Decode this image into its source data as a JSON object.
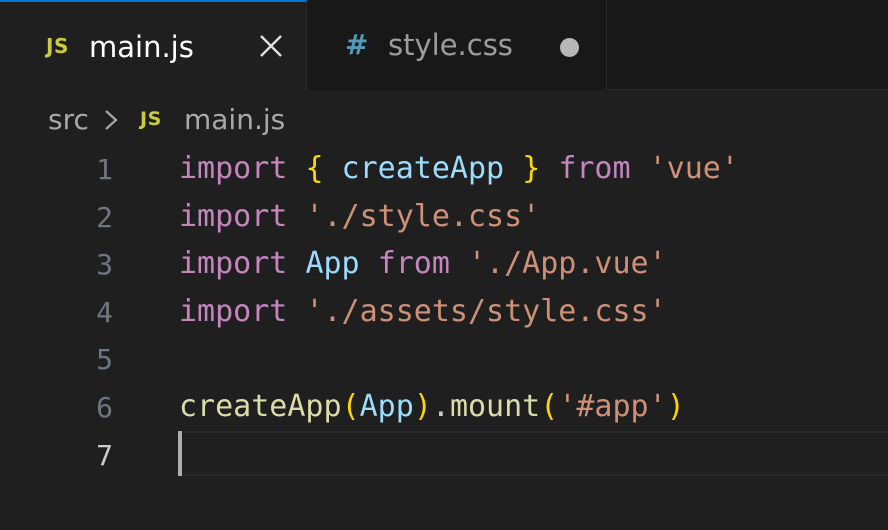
{
  "tabs": [
    {
      "icon": "JS",
      "label": "main.js",
      "active": true,
      "close_glyph": "✕"
    },
    {
      "icon": "#",
      "label": "style.css",
      "active": false,
      "dirty": true
    }
  ],
  "breadcrumb": {
    "folder": "src",
    "separator": "›",
    "file_icon": "JS",
    "file": "main.js"
  },
  "code": {
    "line_numbers": [
      "1",
      "2",
      "3",
      "4",
      "5",
      "6",
      "7"
    ],
    "current_line": 7,
    "lines": [
      {
        "t1": "import",
        "t2": " ",
        "t3": "{",
        "t4": " createApp ",
        "t5": "}",
        "t6": " ",
        "t7": "from",
        "t8": " ",
        "t9": "'vue'"
      },
      {
        "t1": "import",
        "t2": " ",
        "t3": "'./style.css'"
      },
      {
        "t1": "import",
        "t2": " ",
        "t3": "App",
        "t4": " ",
        "t5": "from",
        "t6": " ",
        "t7": "'./App.vue'"
      },
      {
        "t1": "import",
        "t2": " ",
        "t3": "'./assets/style.css'"
      },
      {},
      {
        "t1": "createApp",
        "t2": "(",
        "t3": "App",
        "t4": ")",
        "t5": ".",
        "t6": "mount",
        "t7": "(",
        "t8": "'#app'",
        "t9": ")"
      },
      {}
    ]
  },
  "colors": {
    "keyword": "#c586c0",
    "string": "#ce9178",
    "variable": "#9cdcfe",
    "function": "#dcdcaa",
    "bracket_level1": "#ffd700",
    "bracket_level2": "#da70d6",
    "js_icon": "#cbcb41",
    "css_icon": "#519aba",
    "active_tab_border": "#0078d4"
  }
}
